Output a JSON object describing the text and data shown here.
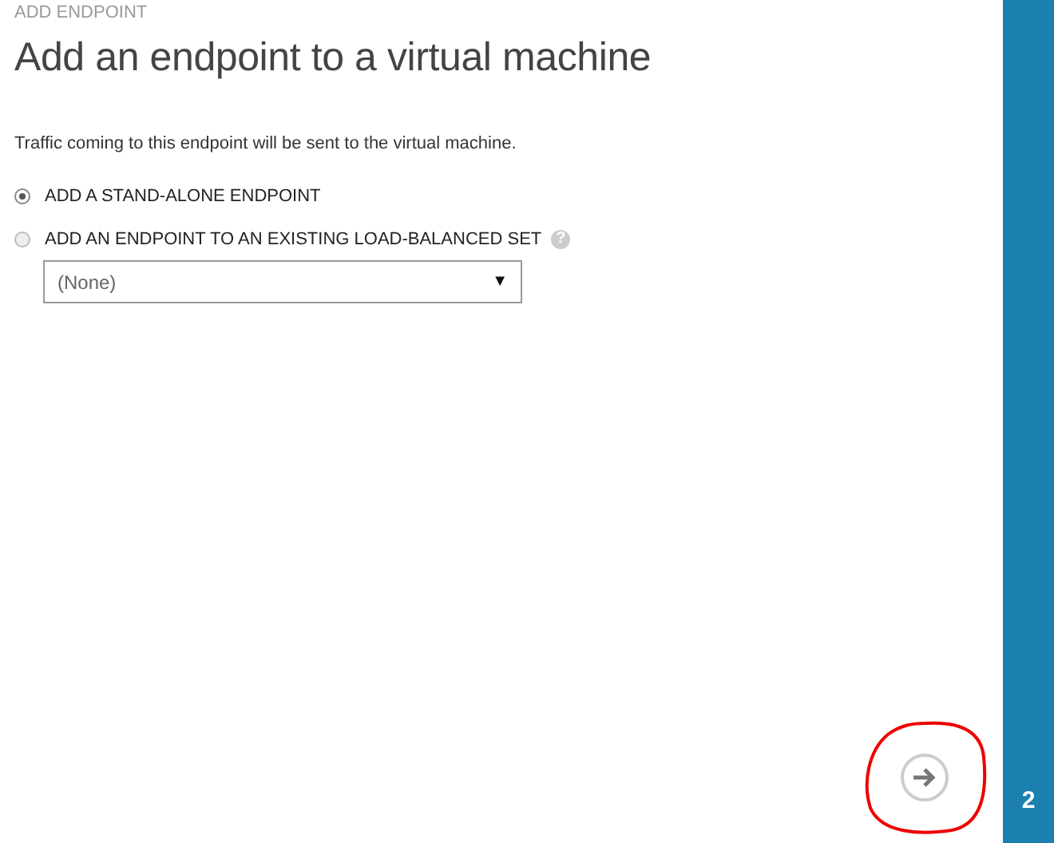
{
  "header": {
    "caption": "ADD ENDPOINT",
    "title": "Add an endpoint to a virtual machine"
  },
  "description": "Traffic coming to this endpoint will be sent to the virtual machine.",
  "options": [
    {
      "label": "ADD A STAND-ALONE ENDPOINT",
      "selected": true
    },
    {
      "label": "ADD AN ENDPOINT TO AN EXISTING LOAD-BALANCED SET",
      "selected": false,
      "help": "?"
    }
  ],
  "load_balanced_set": {
    "value": "(None)",
    "arrow": "▼"
  },
  "step": "2"
}
